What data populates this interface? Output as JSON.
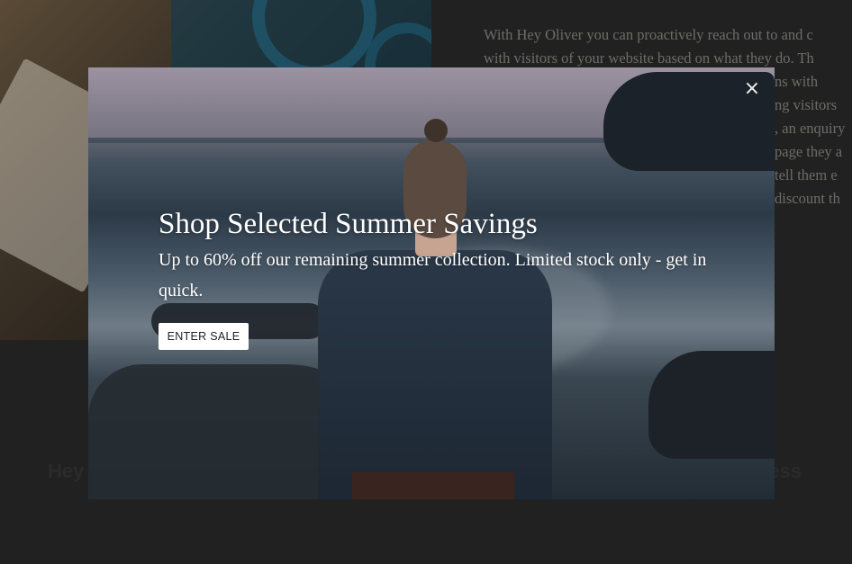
{
  "background": {
    "paragraph_lines": [
      "With Hey Oliver you can proactively reach out to and c",
      "with visitors of your website based on what they do. Th",
      "ns with",
      "ng visitors",
      ", an enquiry",
      "page they a",
      "tell them e",
      "discount th"
    ],
    "heading_left": "Hey",
    "heading_right": "ness"
  },
  "modal": {
    "title": "Shop Selected Summer Savings",
    "subtitle": "Up to 60% off our remaining summer collection. Limited stock only - get in quick.",
    "cta_label": "ENTER SALE",
    "close_glyph": "×"
  }
}
